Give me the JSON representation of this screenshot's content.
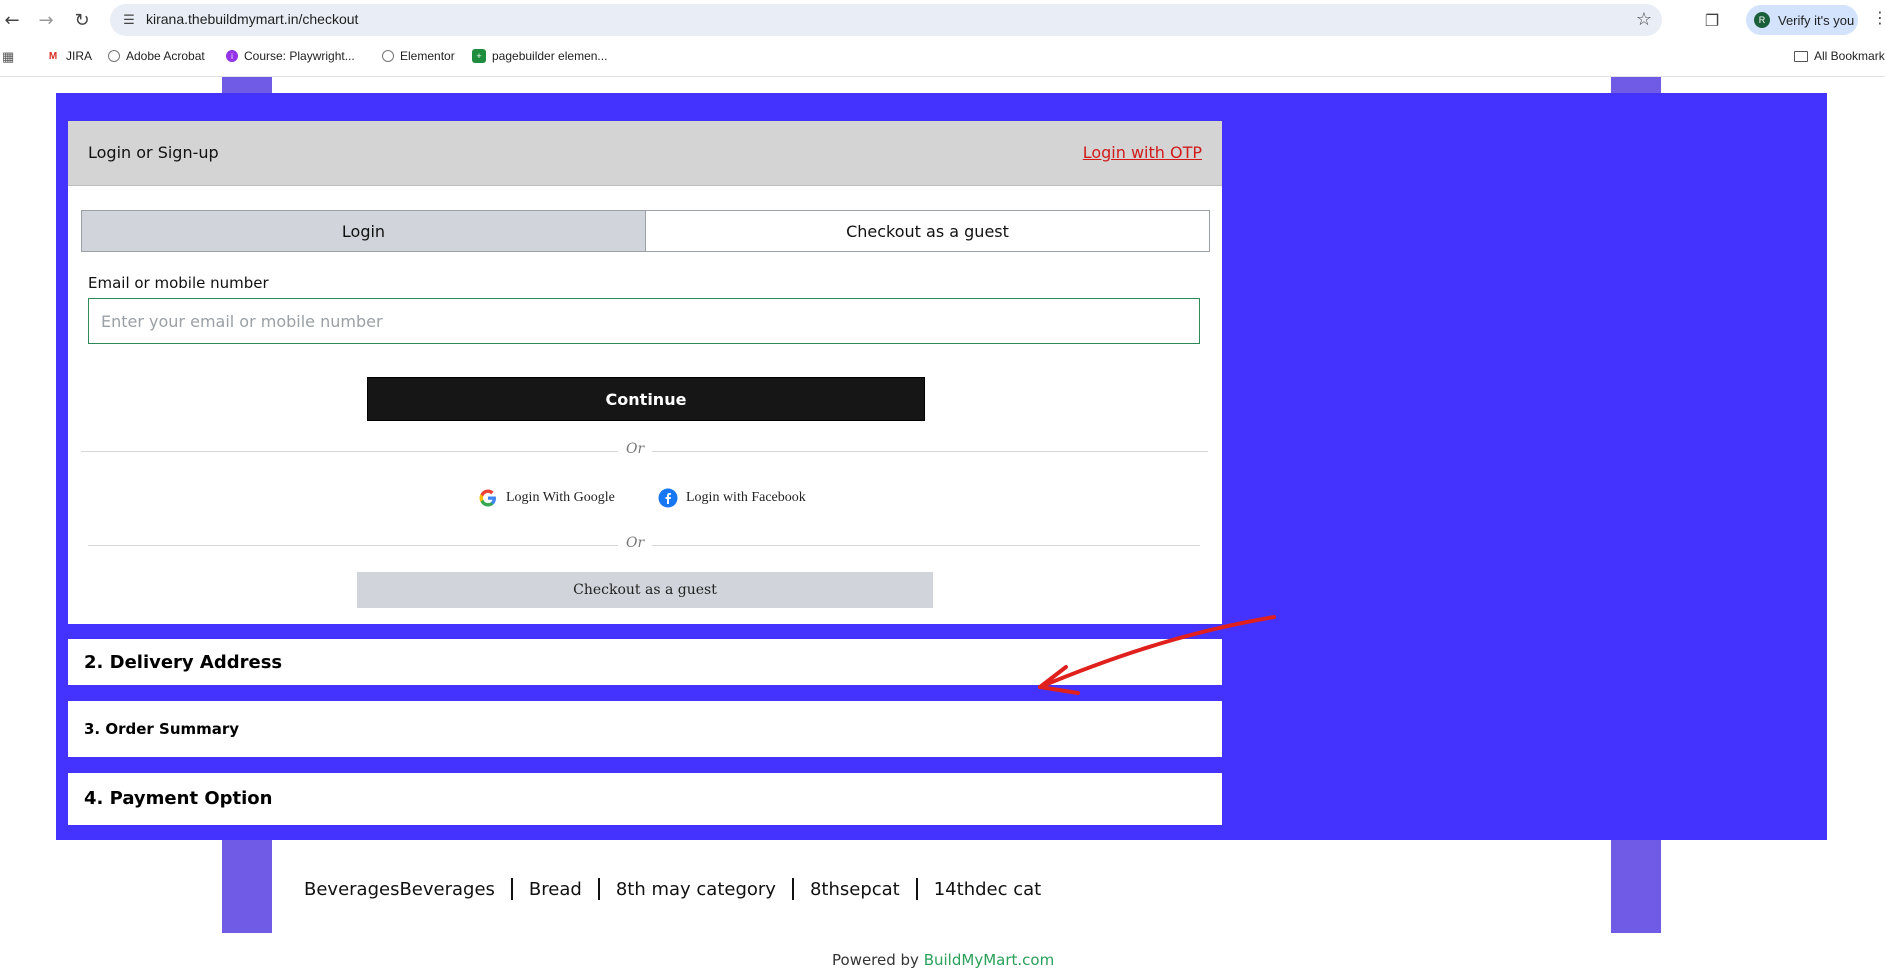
{
  "browser": {
    "url": "kirana.thebuildmymart.in/checkout",
    "profile_chip": "Verify it's you",
    "profile_initial": "R",
    "bookmarks": [
      {
        "label": "JIRA",
        "icon": "gmail-icon"
      },
      {
        "label": "Adobe Acrobat",
        "icon": "globe-icon"
      },
      {
        "label": "Course: Playwright...",
        "icon": "course-icon"
      },
      {
        "label": "Elementor",
        "icon": "globe-icon"
      },
      {
        "label": "pagebuilder elemen...",
        "icon": "sheets-icon"
      }
    ],
    "all_bookmarks": "All Bookmarks"
  },
  "login": {
    "header_title": "Login or Sign-up",
    "otp_link": "Login with OTP",
    "tab_login": "Login",
    "tab_guest": "Checkout as a guest",
    "email_label": "Email or mobile number",
    "email_placeholder": "Enter your email or mobile number",
    "continue_label": "Continue",
    "or_1": "Or",
    "google_label": "Login With Google",
    "facebook_label": "Login with Facebook",
    "or_2": "Or",
    "guest_button": "Checkout as a guest"
  },
  "sections": {
    "delivery": "2. Delivery Address",
    "order_summary": "3. Order Summary",
    "payment": "4. Payment Option"
  },
  "footer": {
    "categories": [
      "BeveragesBeverages",
      "Bread",
      "8th may category",
      "8thsepcat",
      "14thdec cat"
    ],
    "powered_prefix": "Powered by ",
    "powered_link": "BuildMyMart.com"
  },
  "colors": {
    "panel_blue": "#4433ff",
    "strip_purple": "#6f5be6",
    "otp_red": "#d11a1a",
    "continue_bg": "#161616"
  }
}
